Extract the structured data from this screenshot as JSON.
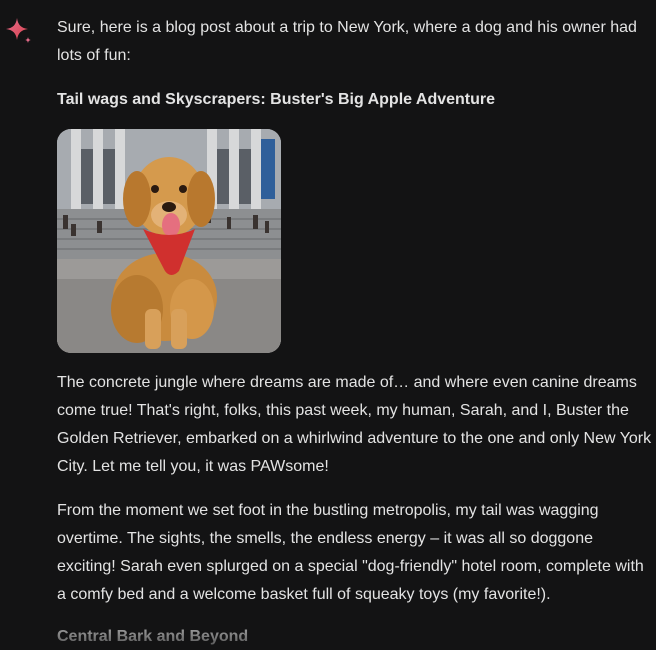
{
  "response": {
    "assistant_icon": "gemini-sparkle-icon",
    "intro": "Sure, here is a blog post about a trip to New York, where a dog and his owner had lots of fun:",
    "title": "Tail wags and Skyscrapers: Buster's Big Apple Adventure",
    "image_description_icon": "golden-retriever-photo",
    "paragraphs": [
      "The concrete jungle where dreams are made of… and where even canine dreams come true! That's right, folks, this past week, my human, Sarah, and I, Buster the Golden Retriever, embarked on a whirlwind adventure to the one and only New York City. Let me tell you, it was PAWsome!",
      "From the moment we set foot in the bustling metropolis, my tail was wagging overtime. The sights, the smells, the endless energy – it was all so doggone exciting! Sarah even splurged on a special \"dog-friendly\" hotel room, complete with a comfy bed and a welcome basket full of squeaky toys (my favorite!)."
    ],
    "subheading": "Central Bark and Beyond"
  },
  "colors": {
    "background": "#131314",
    "text": "#e3e3e3",
    "sparkle_start": "#4f8df5",
    "sparkle_end": "#e2525c"
  }
}
